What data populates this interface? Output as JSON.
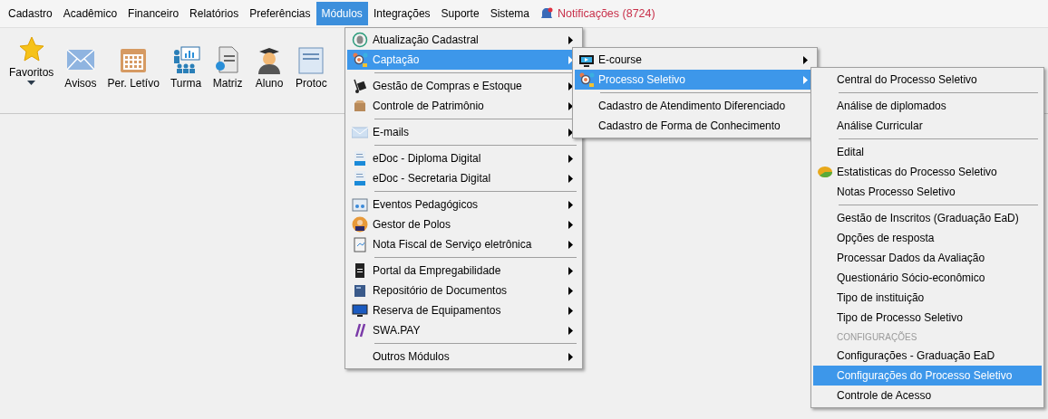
{
  "menubar": {
    "items": [
      {
        "label": "Cadastro",
        "selected": false
      },
      {
        "label": "Acadêmico",
        "selected": false
      },
      {
        "label": "Financeiro",
        "selected": false
      },
      {
        "label": "Relatórios",
        "selected": false
      },
      {
        "label": "Preferências",
        "selected": false
      },
      {
        "label": "Módulos",
        "selected": true
      },
      {
        "label": "Integrações",
        "selected": false
      },
      {
        "label": "Suporte",
        "selected": false
      },
      {
        "label": "Sistema",
        "selected": false
      }
    ],
    "notifications": {
      "label": "Notificações (8724)"
    }
  },
  "toolbar": {
    "items": [
      {
        "label": "Favoritos",
        "dropdown": true
      },
      {
        "label": "Avisos",
        "dropdown": false
      },
      {
        "label": "Per. Letívo",
        "dropdown": false
      },
      {
        "label": "Turma",
        "dropdown": false
      },
      {
        "label": "Matriz",
        "dropdown": false
      },
      {
        "label": "Aluno",
        "dropdown": false
      },
      {
        "label": "Protoc",
        "dropdown": false
      }
    ]
  },
  "menus": [
    {
      "items": [
        {
          "kind": "item",
          "label": "Atualização Cadastral",
          "submenu": true,
          "selected": false
        },
        {
          "kind": "item",
          "label": "Captação",
          "submenu": true,
          "selected": true
        },
        {
          "kind": "separator"
        },
        {
          "kind": "item",
          "label": "Gestão de Compras e Estoque",
          "submenu": true,
          "selected": false
        },
        {
          "kind": "item",
          "label": "Controle de Patrimônio",
          "submenu": true,
          "selected": false
        },
        {
          "kind": "separator"
        },
        {
          "kind": "item",
          "label": "E-mails",
          "submenu": true,
          "selected": false
        },
        {
          "kind": "separator"
        },
        {
          "kind": "item",
          "label": "eDoc - Diploma Digital",
          "submenu": true,
          "selected": false
        },
        {
          "kind": "item",
          "label": "eDoc - Secretaria Digital",
          "submenu": true,
          "selected": false
        },
        {
          "kind": "separator"
        },
        {
          "kind": "item",
          "label": "Eventos Pedagógicos",
          "submenu": true,
          "selected": false
        },
        {
          "kind": "item",
          "label": "Gestor de Polos",
          "submenu": true,
          "selected": false
        },
        {
          "kind": "item",
          "label": "Nota Fiscal de Serviço eletrônica",
          "submenu": true,
          "selected": false
        },
        {
          "kind": "separator"
        },
        {
          "kind": "item",
          "label": "Portal da Empregabilidade",
          "submenu": true,
          "selected": false
        },
        {
          "kind": "item",
          "label": "Repositório de Documentos",
          "submenu": true,
          "selected": false
        },
        {
          "kind": "item",
          "label": "Reserva de Equipamentos",
          "submenu": true,
          "selected": false
        },
        {
          "kind": "item",
          "label": "SWA.PAY",
          "submenu": true,
          "selected": false
        },
        {
          "kind": "separator"
        },
        {
          "kind": "item",
          "label": "Outros Módulos",
          "submenu": true,
          "selected": false
        }
      ]
    },
    {
      "items": [
        {
          "kind": "item",
          "label": "E-course",
          "submenu": true,
          "selected": false
        },
        {
          "kind": "item",
          "label": "Processo Seletivo",
          "submenu": true,
          "selected": true
        },
        {
          "kind": "separator"
        },
        {
          "kind": "item",
          "label": "Cadastro de Atendimento Diferenciado",
          "submenu": false,
          "selected": false
        },
        {
          "kind": "item",
          "label": "Cadastro de Forma de Conhecimento",
          "submenu": false,
          "selected": false
        }
      ]
    },
    {
      "items": [
        {
          "kind": "item",
          "label": "Central do Processo Seletivo",
          "submenu": false,
          "selected": false
        },
        {
          "kind": "separator"
        },
        {
          "kind": "item",
          "label": "Análise de diplomados",
          "submenu": false,
          "selected": false
        },
        {
          "kind": "item",
          "label": "Análise Curricular",
          "submenu": false,
          "selected": false
        },
        {
          "kind": "separator"
        },
        {
          "kind": "item",
          "label": "Edital",
          "submenu": false,
          "selected": false
        },
        {
          "kind": "item",
          "label": "Estatisticas do Processo Seletivo",
          "submenu": false,
          "selected": false
        },
        {
          "kind": "item",
          "label": "Notas Processo Seletivo",
          "submenu": false,
          "selected": false
        },
        {
          "kind": "separator"
        },
        {
          "kind": "item",
          "label": "Gestão de Inscritos (Graduação EaD)",
          "submenu": false,
          "selected": false
        },
        {
          "kind": "item",
          "label": "Opções de resposta",
          "submenu": false,
          "selected": false
        },
        {
          "kind": "item",
          "label": "Processar Dados da Avaliação",
          "submenu": false,
          "selected": false
        },
        {
          "kind": "item",
          "label": "Questionário Sócio-econômico",
          "submenu": false,
          "selected": false
        },
        {
          "kind": "item",
          "label": "Tipo de instituição",
          "submenu": false,
          "selected": false
        },
        {
          "kind": "item",
          "label": "Tipo de Processo Seletivo",
          "submenu": false,
          "selected": false
        },
        {
          "kind": "header",
          "label": "CONFIGURAÇÕES"
        },
        {
          "kind": "item",
          "label": "Configurações - Graduação EaD",
          "submenu": false,
          "selected": false
        },
        {
          "kind": "item",
          "label": "Configurações do Processo Seletivo",
          "submenu": false,
          "selected": true
        },
        {
          "kind": "item",
          "label": "Controle de Acesso",
          "submenu": false,
          "selected": false
        }
      ]
    }
  ]
}
